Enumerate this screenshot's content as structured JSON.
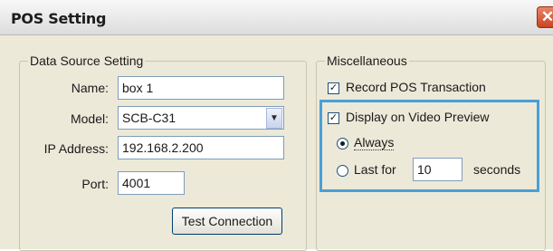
{
  "window": {
    "title": "POS Setting",
    "close_symbol": "✕"
  },
  "data_source": {
    "legend": "Data Source Setting",
    "name_label": "Name:",
    "name_value": "box 1",
    "model_label": "Model:",
    "model_value": "SCB-C31",
    "ip_label": "IP Address:",
    "ip_value": "192.168.2.200",
    "port_label": "Port:",
    "port_value": "4001",
    "test_button": "Test Connection"
  },
  "misc": {
    "legend": "Miscellaneous",
    "record_label": "Record POS Transaction",
    "record_checked": true,
    "display_label": "Display on Video Preview",
    "display_checked": true,
    "always_label": "Always",
    "always_selected": true,
    "lastfor_label": "Last for",
    "lastfor_value": "10",
    "seconds_label": "seconds"
  },
  "colors": {
    "highlight": "#4a9fd6",
    "window_bg": "#ece9d8"
  }
}
